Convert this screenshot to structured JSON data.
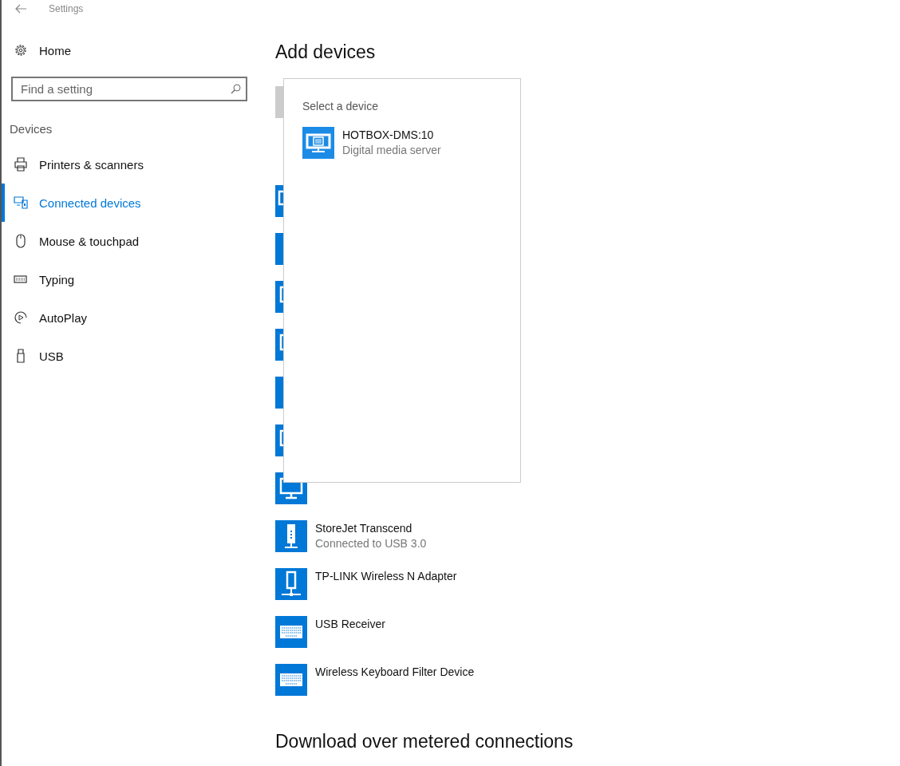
{
  "window": {
    "title": "Settings"
  },
  "sidebar": {
    "home": "Home",
    "search": {
      "placeholder": "Find a setting"
    },
    "section": "Devices",
    "items": [
      {
        "label": "Printers & scanners",
        "kind": "printer",
        "selected": false
      },
      {
        "label": "Connected devices",
        "kind": "devices",
        "selected": true
      },
      {
        "label": "Mouse & touchpad",
        "kind": "mouse",
        "selected": false
      },
      {
        "label": "Typing",
        "kind": "keyboard",
        "selected": false
      },
      {
        "label": "AutoPlay",
        "kind": "autoplay",
        "selected": false
      },
      {
        "label": "USB",
        "kind": "usb",
        "selected": false
      }
    ]
  },
  "main": {
    "title": "Add devices",
    "devices": [
      {
        "kind": "media"
      },
      {
        "kind": "generic"
      },
      {
        "kind": "monitor"
      },
      {
        "kind": "monitor"
      },
      {
        "kind": "generic"
      },
      {
        "kind": "monitor"
      },
      {
        "kind": "monitor"
      },
      {
        "kind": "drive",
        "name": "StoreJet Transcend",
        "status": "Connected to USB 3.0"
      },
      {
        "kind": "network",
        "name": "TP-LINK Wireless N Adapter"
      },
      {
        "kind": "keyboard",
        "name": "USB Receiver"
      },
      {
        "kind": "keyboard",
        "name": "Wireless Keyboard Filter Device"
      }
    ],
    "footer_heading": "Download over metered connections"
  },
  "popup": {
    "title": "Select a device",
    "devices": [
      {
        "kind": "media",
        "name": "HOTBOX-DMS:10",
        "description": "Digital media server"
      }
    ]
  }
}
